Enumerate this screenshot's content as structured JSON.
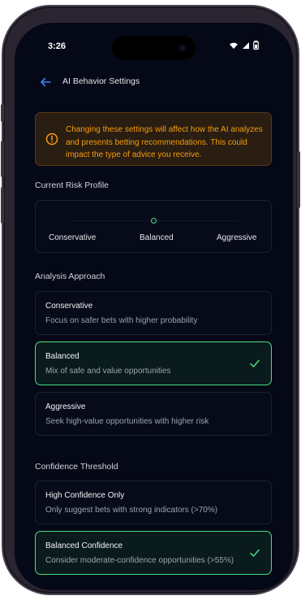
{
  "status_bar": {
    "time": "3:26"
  },
  "header": {
    "title": "AI Behavior Settings"
  },
  "warning": {
    "text": "Changing these settings will affect how the AI analyzes and presents betting recommendations. This could impact the type of advice you receive."
  },
  "risk_profile": {
    "label": "Current Risk Profile",
    "options": [
      "Conservative",
      "Balanced",
      "Aggressive"
    ],
    "selected": "Balanced"
  },
  "analysis": {
    "label": "Analysis Approach",
    "options": [
      {
        "title": "Conservative",
        "desc": "Focus on safer bets with higher probability",
        "selected": false
      },
      {
        "title": "Balanced",
        "desc": "Mix of safe and value opportunities",
        "selected": true
      },
      {
        "title": "Aggressive",
        "desc": "Seek high-value opportunities with higher risk",
        "selected": false
      }
    ]
  },
  "confidence": {
    "label": "Confidence Threshold",
    "options": [
      {
        "title": "High Confidence Only",
        "desc": "Only suggest bets with strong indicators (>70%)",
        "selected": false
      },
      {
        "title": "Balanced Confidence",
        "desc": "Consider moderate-confidence opportunities (>55%)",
        "selected": true
      }
    ]
  },
  "colors": {
    "accent": "#4ade80",
    "warning": "#f59e0b",
    "back": "#3b82f6",
    "background": "#050816"
  }
}
